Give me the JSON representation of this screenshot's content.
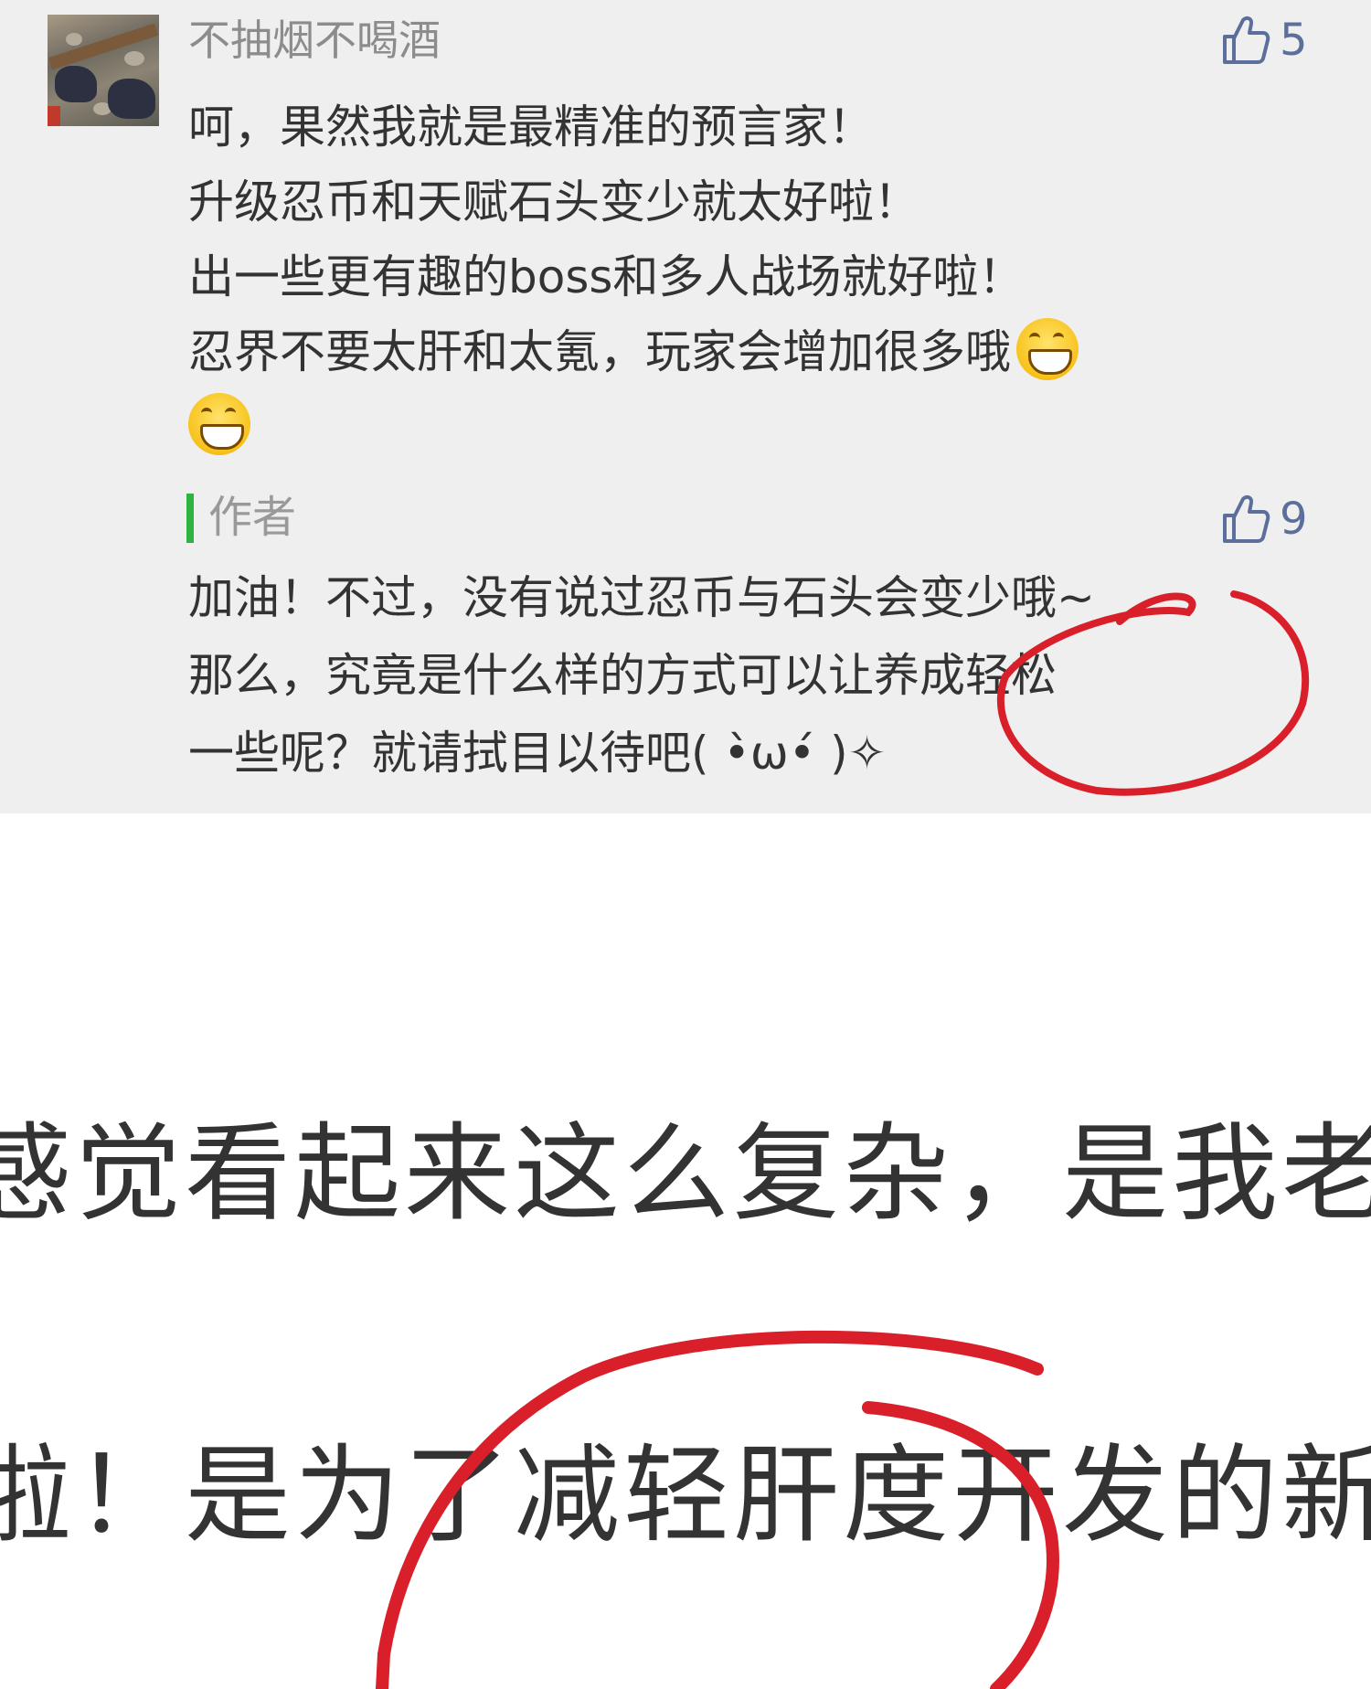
{
  "comment": {
    "username": "不抽烟不喝酒",
    "likes": "5",
    "lines": [
      "呵，果然我就是最精准的预言家！",
      "升级忍币和天赋石头变少就太好啦！",
      "出一些更有趣的boss和多人战场就好啦！",
      "忍界不要太肝和太氪，玩家会增加很多哦"
    ],
    "emoji": "grinning-face"
  },
  "reply": {
    "author_label": "作者",
    "likes": "9",
    "lines": [
      "加油！不过，没有说过忍币与石头会变少哦~",
      "那么，究竟是什么样的方式可以让养成轻松",
      "一些呢？就请拭目以待吧( •̀ω•́ )✧"
    ]
  },
  "zoomed_text": {
    "line1": "感觉看起来这么复杂，是我老",
    "line2": "啦！是为了减轻肝度开发的新"
  },
  "colors": {
    "panel_bg": "#efefef",
    "text": "#333333",
    "username": "#8c8c8c",
    "like_accent": "#5c6f9c",
    "author_bar": "#2fb340",
    "annotation": "#d91f2a"
  }
}
